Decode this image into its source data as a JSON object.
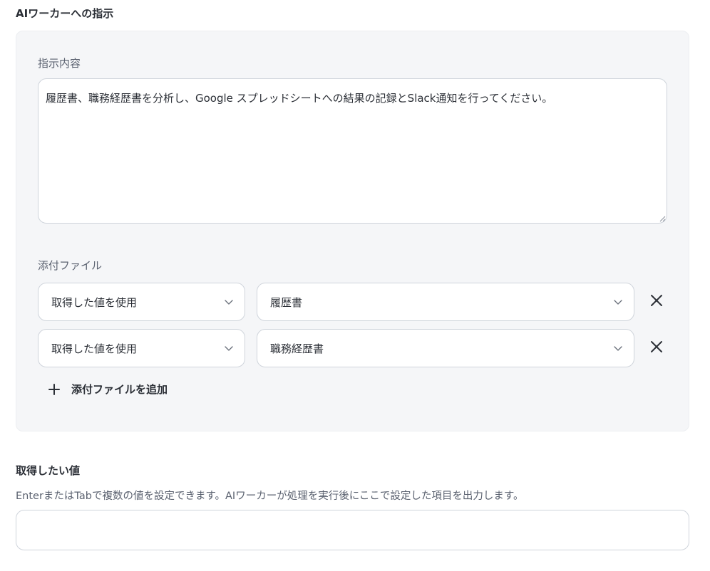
{
  "section_title": "AIワーカーへの指示",
  "instructions": {
    "label": "指示内容",
    "value": "履歴書、職務経歴書を分析し、Google スプレッドシートへの結果の記録とSlack通知を行ってください。"
  },
  "attachments": {
    "label": "添付ファイル",
    "rows": [
      {
        "source": "取得した値を使用",
        "value": "履歴書"
      },
      {
        "source": "取得した値を使用",
        "value": "職務経歴書"
      }
    ],
    "add_label": "添付ファイルを追加"
  },
  "get_values": {
    "title": "取得したい値",
    "description": "EnterまたはTabで複数の値を設定できます。AIワーカーが処理を実行後にここで設定した項目を出力します。",
    "input_value": ""
  },
  "icons": {
    "chevron": "chevron-down-icon",
    "remove": "close-icon",
    "add": "plus-icon",
    "resize": "resize-grip-icon"
  },
  "colors": {
    "panel_bg": "#f5f6f8",
    "border": "#cfd4db",
    "text": "#2b2f36",
    "muted": "#5b6270"
  }
}
